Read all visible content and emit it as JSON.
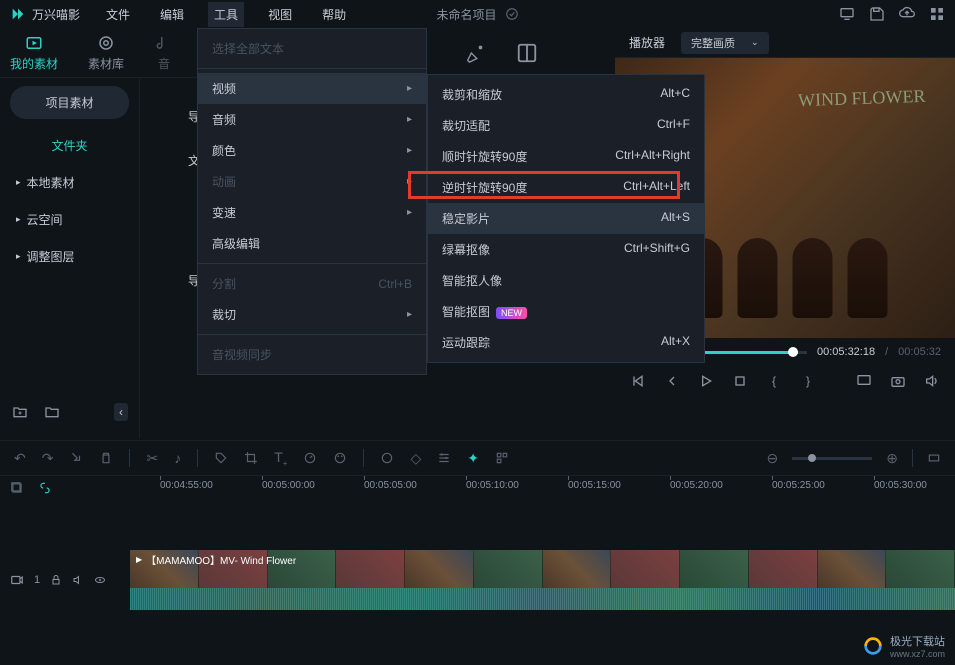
{
  "app": {
    "name": "万兴喵影"
  },
  "menubar": [
    "文件",
    "编辑",
    "工具",
    "视图",
    "帮助"
  ],
  "project": {
    "name": "未命名项目"
  },
  "toptabs": {
    "my_assets": "我的素材",
    "asset_lib": "素材库",
    "audio_partial": "音"
  },
  "sidebar": {
    "project_assets": "项目素材",
    "folder": "文件夹",
    "items": [
      "本地素材",
      "云空间",
      "调整图层"
    ]
  },
  "center": {
    "import_prefix": "导",
    "import": "导入",
    "file_partial": "文件"
  },
  "dropdown1": {
    "select_all_text": "选择全部文本",
    "video": "视频",
    "audio": "音频",
    "color": "颜色",
    "animation": "动画",
    "speed": "变速",
    "advanced_edit": "高级编辑",
    "split": "分割",
    "split_key": "Ctrl+B",
    "crop": "裁切",
    "av_sync": "音视频同步"
  },
  "dropdown2": {
    "crop_zoom": {
      "label": "裁剪和缩放",
      "key": "Alt+C"
    },
    "crop_fit": {
      "label": "裁切适配",
      "key": "Ctrl+F"
    },
    "rotate_cw": {
      "label": "顺时针旋转90度",
      "key": "Ctrl+Alt+Right"
    },
    "rotate_ccw": {
      "label": "逆时针旋转90度",
      "key": "Ctrl+Alt+Left"
    },
    "stabilize": {
      "label": "稳定影片",
      "key": "Alt+S"
    },
    "green_screen": {
      "label": "绿幕抠像",
      "key": "Ctrl+Shift+G"
    },
    "smart_portrait": {
      "label": "智能抠人像",
      "key": ""
    },
    "smart_cutout": {
      "label": "智能抠图",
      "key": "",
      "badge": "NEW"
    },
    "motion_track": {
      "label": "运动跟踪",
      "key": "Alt+X"
    }
  },
  "preview": {
    "player": "播放器",
    "quality": "完整画质",
    "graffiti": "WIND FLOWER",
    "time_current": "00:05:32:18",
    "time_total": "00:05:32"
  },
  "timeline": {
    "ticks": [
      "00:04:55:00",
      "00:05:00:00",
      "00:05:05:00",
      "00:05:10:00",
      "00:05:15:00",
      "00:05:20:00",
      "00:05:25:00",
      "00:05:30:00"
    ],
    "track_index": "1",
    "clip_name": "【MAMAMOO】MV- Wind Flower"
  },
  "watermark": {
    "text": "极光下载站",
    "url": "www.xz7.com"
  }
}
